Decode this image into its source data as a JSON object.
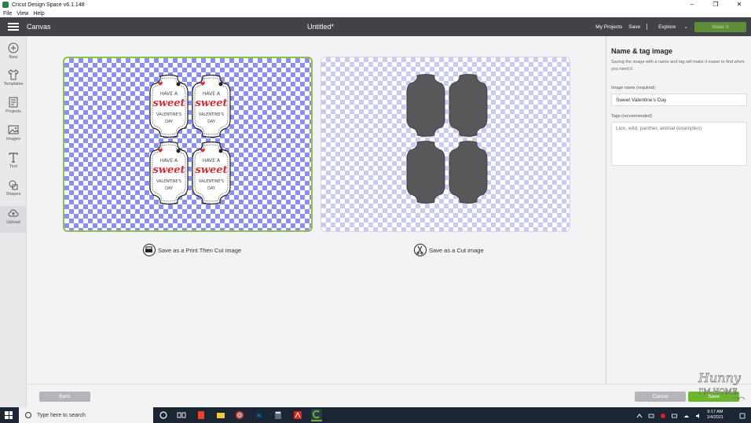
{
  "window": {
    "title": "Cricut Design Space  v6.1.148",
    "controls": [
      "–",
      "❐",
      "✕"
    ]
  },
  "menu": [
    "File",
    "View",
    "Help"
  ],
  "header": {
    "section": "Canvas",
    "document_title": "Untitled*",
    "my_projects": "My Projects",
    "save": "Save",
    "explore": "Explore",
    "make_it": "Make It"
  },
  "toolbar": [
    {
      "label": "New",
      "icon": "plus-circle-icon"
    },
    {
      "label": "Templates",
      "icon": "shirt-icon"
    },
    {
      "label": "Projects",
      "icon": "projects-icon"
    },
    {
      "label": "Images",
      "icon": "image-icon"
    },
    {
      "label": "Text",
      "icon": "text-icon"
    },
    {
      "label": "Shapes",
      "icon": "shapes-icon"
    },
    {
      "label": "Upload",
      "icon": "upload-cloud-icon"
    }
  ],
  "previews": {
    "tag_text": [
      "HAVE A",
      "sweet",
      "VALENTINE'S",
      "DAY"
    ],
    "print_option": "Save as a Print Then Cut image",
    "cut_option": "Save as a Cut image"
  },
  "panel": {
    "title": "Name & tag image",
    "description": "Saving the image with a name and tag will make it easier to find when you need it.",
    "name_label": "Image name (required)",
    "name_value": "Sweet Valentine's Day",
    "tags_label": "Tags (recommended)",
    "tags_placeholder": "Lion, wild, panther, animal (examples)"
  },
  "footer": {
    "back": "Back",
    "cancel": "Cancel",
    "save": "Save"
  },
  "watermark": [
    "Hunny",
    "I'M HOME"
  ],
  "taskbar": {
    "search_placeholder": "Type here to search",
    "time": "9:17 AM",
    "date": "1/4/2021"
  },
  "colors": {
    "header_bg": "#414346",
    "accent_green": "#6cb52d",
    "checker_print": "#8a8ff0",
    "checker_cut": "#c9cbf3",
    "cut_shape": "#58585a",
    "tag_red": "#d42e36"
  }
}
